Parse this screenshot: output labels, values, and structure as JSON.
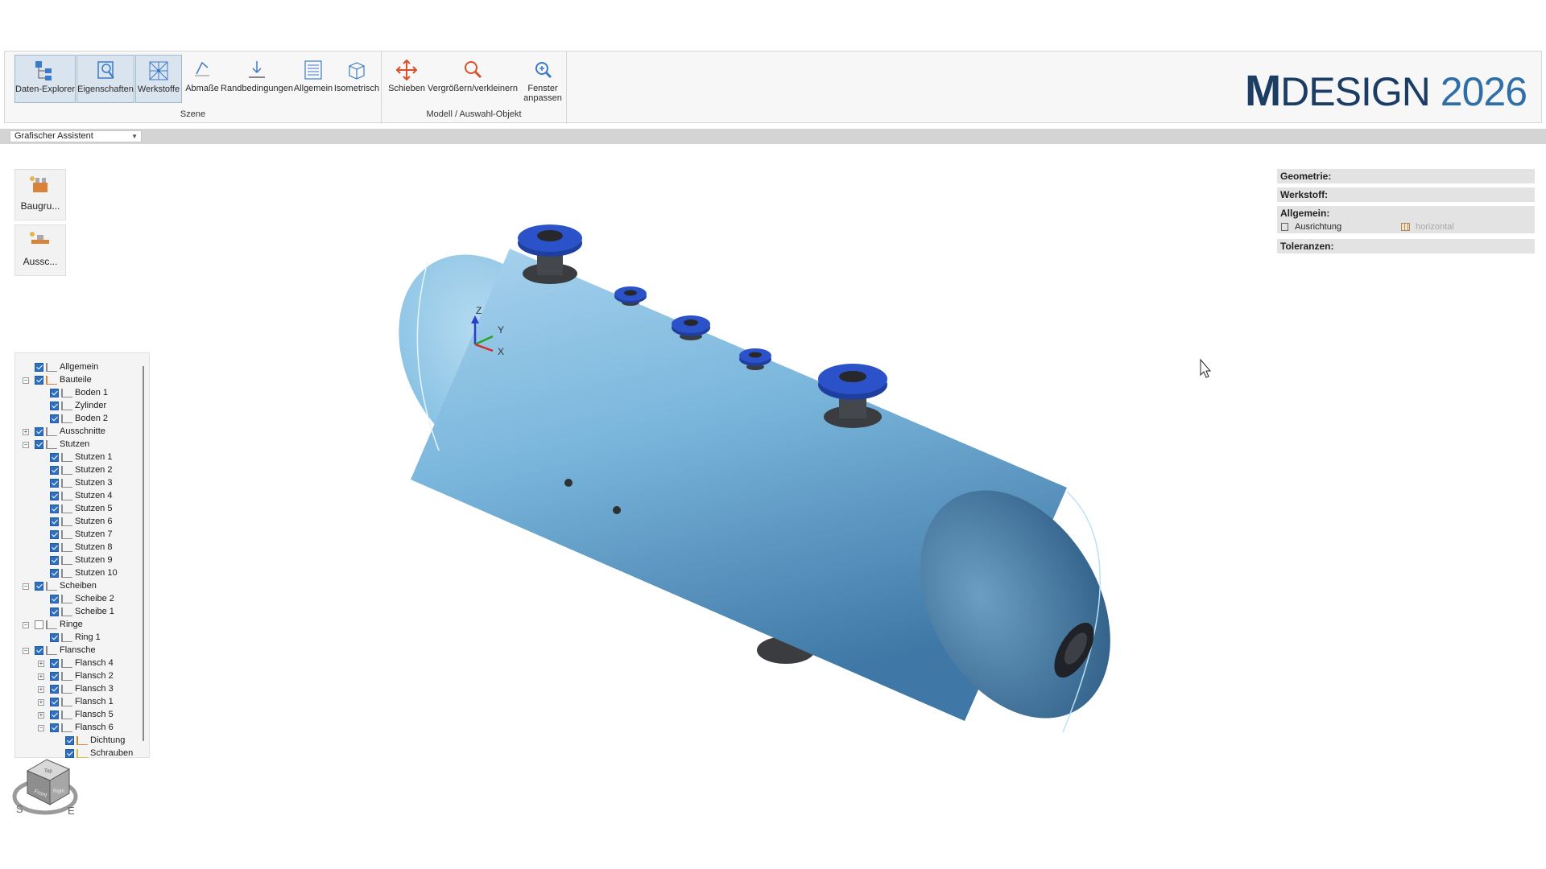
{
  "ribbon": {
    "groups": [
      {
        "label": "Szene"
      },
      {
        "label": "Modell / Auswahl-Objekt"
      }
    ],
    "buttons": [
      {
        "label": "Daten-Explorer"
      },
      {
        "label": "Eigenschaften"
      },
      {
        "label": "Werkstoffe"
      },
      {
        "label": "Abmaße"
      },
      {
        "label": "Randbedingungen"
      },
      {
        "label": "Allgemein"
      },
      {
        "label": "Isometrisch"
      },
      {
        "label": "Schieben"
      },
      {
        "label": "Vergrößern/verkleinern"
      },
      {
        "label": "Fenster anpassen"
      }
    ]
  },
  "logo": {
    "brand_bold": "M",
    "brand_rest": "DESIGN",
    "year": "2026"
  },
  "assistant": {
    "selected": "Grafischer Assistent"
  },
  "tools": [
    {
      "label": "Baugru..."
    },
    {
      "label": "Aussc..."
    }
  ],
  "tree": [
    {
      "label": "Allgemein",
      "checked": true
    },
    {
      "label": "Bauteile",
      "checked": true
    },
    {
      "label": "Boden 1",
      "checked": true
    },
    {
      "label": "Zylinder",
      "checked": true
    },
    {
      "label": "Boden 2",
      "checked": true
    },
    {
      "label": "Ausschnitte",
      "checked": true
    },
    {
      "label": "Stutzen",
      "checked": true
    },
    {
      "label": "Stutzen 1",
      "checked": true
    },
    {
      "label": "Stutzen 2",
      "checked": true
    },
    {
      "label": "Stutzen 3",
      "checked": true
    },
    {
      "label": "Stutzen 4",
      "checked": true
    },
    {
      "label": "Stutzen 5",
      "checked": true
    },
    {
      "label": "Stutzen 6",
      "checked": true
    },
    {
      "label": "Stutzen 7",
      "checked": true
    },
    {
      "label": "Stutzen 8",
      "checked": true
    },
    {
      "label": "Stutzen 9",
      "checked": true
    },
    {
      "label": "Stutzen 10",
      "checked": true
    },
    {
      "label": "Scheiben",
      "checked": true
    },
    {
      "label": "Scheibe 2",
      "checked": true
    },
    {
      "label": "Scheibe 1",
      "checked": true
    },
    {
      "label": "Ringe",
      "checked": false
    },
    {
      "label": "Ring 1",
      "checked": true
    },
    {
      "label": "Flansche",
      "checked": true
    },
    {
      "label": "Flansch 4",
      "checked": true
    },
    {
      "label": "Flansch 2",
      "checked": true
    },
    {
      "label": "Flansch 3",
      "checked": true
    },
    {
      "label": "Flansch 1",
      "checked": true
    },
    {
      "label": "Flansch 5",
      "checked": true
    },
    {
      "label": "Flansch 6",
      "checked": true
    },
    {
      "label": "Dichtung",
      "checked": true
    },
    {
      "label": "Schrauben",
      "checked": true
    }
  ],
  "properties": {
    "geometrie": "Geometrie:",
    "werkstoff": "Werkstoff:",
    "allgemein": "Allgemein:",
    "ausrichtung_label": "Ausrichtung",
    "ausrichtung_value": "horizontal",
    "toleranzen": "Toleranzen:"
  },
  "axes": {
    "x": "X",
    "y": "Y",
    "z": "Z"
  },
  "viewcube": {
    "front": "Front",
    "top": "Top",
    "right": "Right",
    "compass_s": "S",
    "compass_e": "E"
  },
  "colors": {
    "vessel": "#7ab6dc",
    "flange": "#2b52c8",
    "accent": "#2e6fc0"
  }
}
